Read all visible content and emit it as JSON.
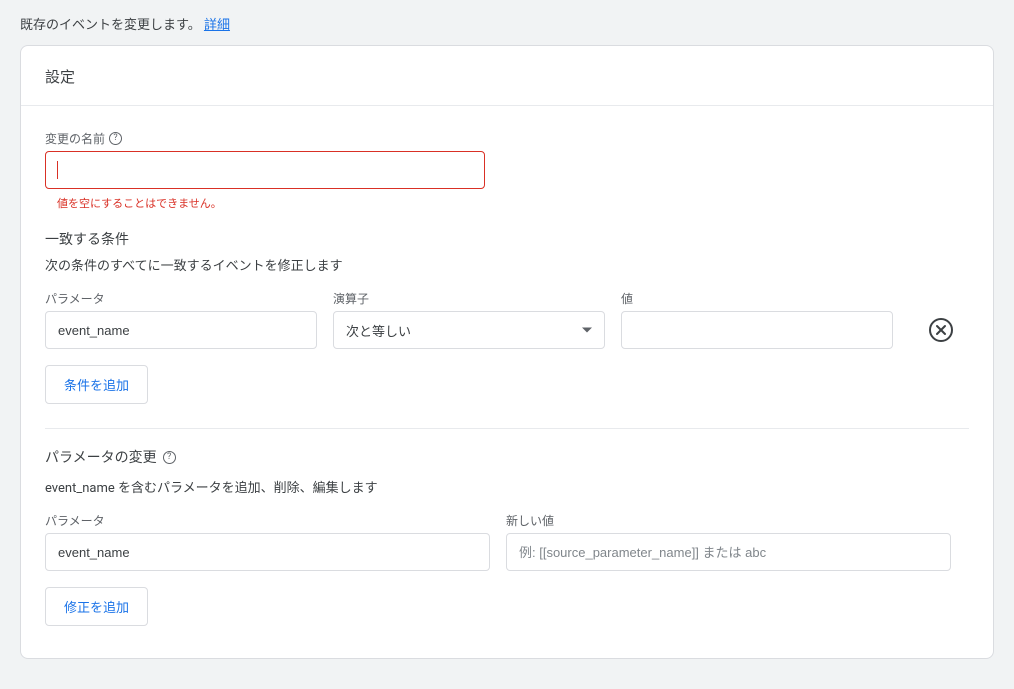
{
  "intro": {
    "text": "既存のイベントを変更します。",
    "link": "詳細"
  },
  "card": {
    "title": "設定"
  },
  "name_field": {
    "label": "変更の名前",
    "value": "",
    "error": "値を空にすることはできません。"
  },
  "conditions": {
    "title": "一致する条件",
    "description": "次の条件のすべてに一致するイベントを修正します",
    "columns": {
      "parameter": "パラメータ",
      "operator": "演算子",
      "value": "値"
    },
    "row": {
      "parameter": "event_name",
      "operator": "次と等しい",
      "value": ""
    },
    "add_button": "条件を追加"
  },
  "modifications": {
    "title": "パラメータの変更",
    "description": "event_name を含むパラメータを追加、削除、編集します",
    "columns": {
      "parameter": "パラメータ",
      "new_value": "新しい値"
    },
    "row": {
      "parameter": "event_name",
      "placeholder": "例: [[source_parameter_name]] または abc"
    },
    "add_button": "修正を追加"
  }
}
